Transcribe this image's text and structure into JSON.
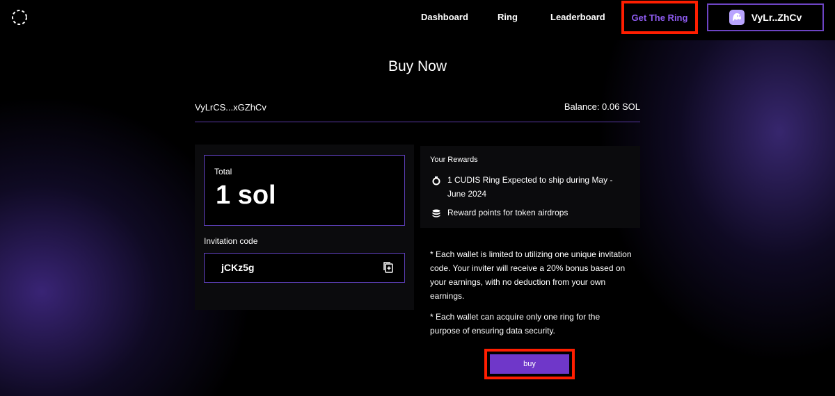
{
  "header": {
    "logo_icon": "loading-circle-icon",
    "nav": [
      {
        "label": "Dashboard"
      },
      {
        "label": "Ring"
      },
      {
        "label": "Leaderboard"
      },
      {
        "label": "Get The Ring",
        "active": true
      }
    ],
    "wallet": {
      "label": "VyLr..ZhCv",
      "icon": "ghost-wallet-icon"
    }
  },
  "page": {
    "title": "Buy Now",
    "address": "VyLrCS...xGZhCv",
    "balance": "Balance: 0.06 SOL"
  },
  "order": {
    "total_label": "Total",
    "total_value": "1 sol",
    "invitation_label": "Invitation code",
    "invitation_code": "jCKz5g",
    "copy_icon": "copy-plus-icon"
  },
  "rewards": {
    "title": "Your Rewards",
    "items": [
      {
        "icon": "ring-icon",
        "text": "1 CUDIS Ring Expected to ship during May - June 2024"
      },
      {
        "icon": "coins-stack-icon",
        "text": "Reward points for token airdrops"
      }
    ]
  },
  "notes": [
    "* Each wallet is limited to utilizing one unique invitation code. Your inviter will receive a 20% bonus based on your earnings, with no deduction from your own earnings.",
    "* Each wallet can acquire only one ring for the purpose of ensuring data security."
  ],
  "buy_label": "buy",
  "colors": {
    "accent": "#6f37c9",
    "nav_active": "#8e5bf0",
    "border": "#5d3fb8",
    "highlight": "#ff1e00"
  }
}
